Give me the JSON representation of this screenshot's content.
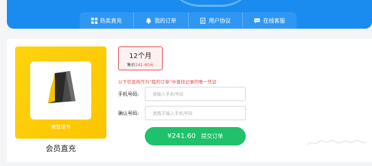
{
  "nav": {
    "items": [
      {
        "label": "热卖直充",
        "icon": "grid-icon"
      },
      {
        "label": "我的订单",
        "icon": "bell-icon"
      },
      {
        "label": "用户协议",
        "icon": "document-icon"
      },
      {
        "label": "在线客服",
        "icon": "chat-icon"
      }
    ]
  },
  "product": {
    "card_label": "美登读书",
    "title": "会员直充",
    "logo_icon": "book-logo-icon"
  },
  "plan": {
    "name": "12个月",
    "price_prefix": "售价",
    "price_amount": "241.60元"
  },
  "notice": "以下信息将作为“我的订单”中查找记录的唯一凭证",
  "form": {
    "phone_label": "手机号码:",
    "phone_placeholder": "请输入手机号码",
    "confirm_label": "确认号码:",
    "confirm_placeholder": "请再次输入手机号码"
  },
  "submit": {
    "price": "¥241.60",
    "label": "提交订单"
  },
  "colors": {
    "brand_blue": "#1a8cf0",
    "accent_red": "#e04a4a",
    "card_yellow": "#ffd30f",
    "submit_green": "#1fc16a"
  }
}
